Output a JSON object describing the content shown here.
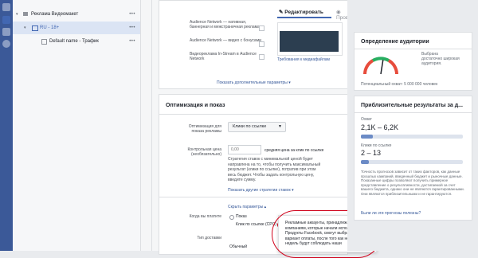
{
  "tree": {
    "campaign": "Реклама Видеомакет",
    "adset": "RU - 18+",
    "ad": "Default name - Трафик",
    "dots": "•••"
  },
  "preview_tabs": {
    "edit": "Редактировать",
    "preview": "Проверка"
  },
  "placements": {
    "items": [
      "Audience Network — нативная, баннерная и межстраничная реклама",
      "Audience Network — видео с бонусами",
      "Видеореклама In-Stream в Audience Network"
    ],
    "requirements_link": "Требования к медиафайлам",
    "show_more": "Показать дополнительные параметры ▾"
  },
  "optimization": {
    "section_title": "Оптимизация и показ",
    "opt_label": "Оптимизация для показа рекламы",
    "opt_value": "Клики по ссылке",
    "bid_label": "Контрольная цена (необязательно)",
    "bid_placeholder": "0,00",
    "bid_suffix": "средняя цена за клик по ссылке",
    "bid_help": "Стратегия ставок с минимальной ценой будет направлена на то, чтобы получить максимальный результат (клики по ссылке), потратив при этом весь бюджет. Чтобы задать контрольную цену, введите сумму.",
    "other_strategy_link": "Показать другие стратегии ставок ▾",
    "hide_params": "Скрыть параметры ▴",
    "when_charged_label": "Когда вы платите",
    "when_option_1": "Показ",
    "when_option_2": "Клик по ссылке (CPC)",
    "delivery_label": "Тип доставки",
    "delivery_value": "Обычный"
  },
  "tooltip": "Рекламные аккаунты, принадлежащие компаниям, которые начали использовать Продукты Facebook, смогут выбрать этот вариант оплаты, после того как несколько недель будут соблюдать наши",
  "audience": {
    "title": "Определение аудитории",
    "gauge_text": "Выбрана достаточно широкая аудитория.",
    "potential_reach": "Потенциальный охват: 5 000 000 человек",
    "gauge_level": 0.55
  },
  "results": {
    "title": "Приблизительные результаты за д...",
    "reach_label": "Охват",
    "reach_value": "2,1K – 6,2K",
    "reach_fill": 0.12,
    "clicks_label": "Клики по ссылке",
    "clicks_value": "2 – 13",
    "clicks_fill": 0.08,
    "note": "Точность прогнозов зависит от таких факторов, как данные прошлых кампаний, введенный бюджет и рыночные данные. Показанные цифры позволяют получить примерное представление о результативности, достигаемой за счет вашего бюджета, однако они не являются гарантированными. Они являются приблизительными и не гарантируются.",
    "helpful_link": "Были ли эти прогнозы полезны?"
  },
  "colors": {
    "accent": "#4267b2",
    "rail": "#3b5998",
    "tooltip_circle": "#d0021b"
  }
}
